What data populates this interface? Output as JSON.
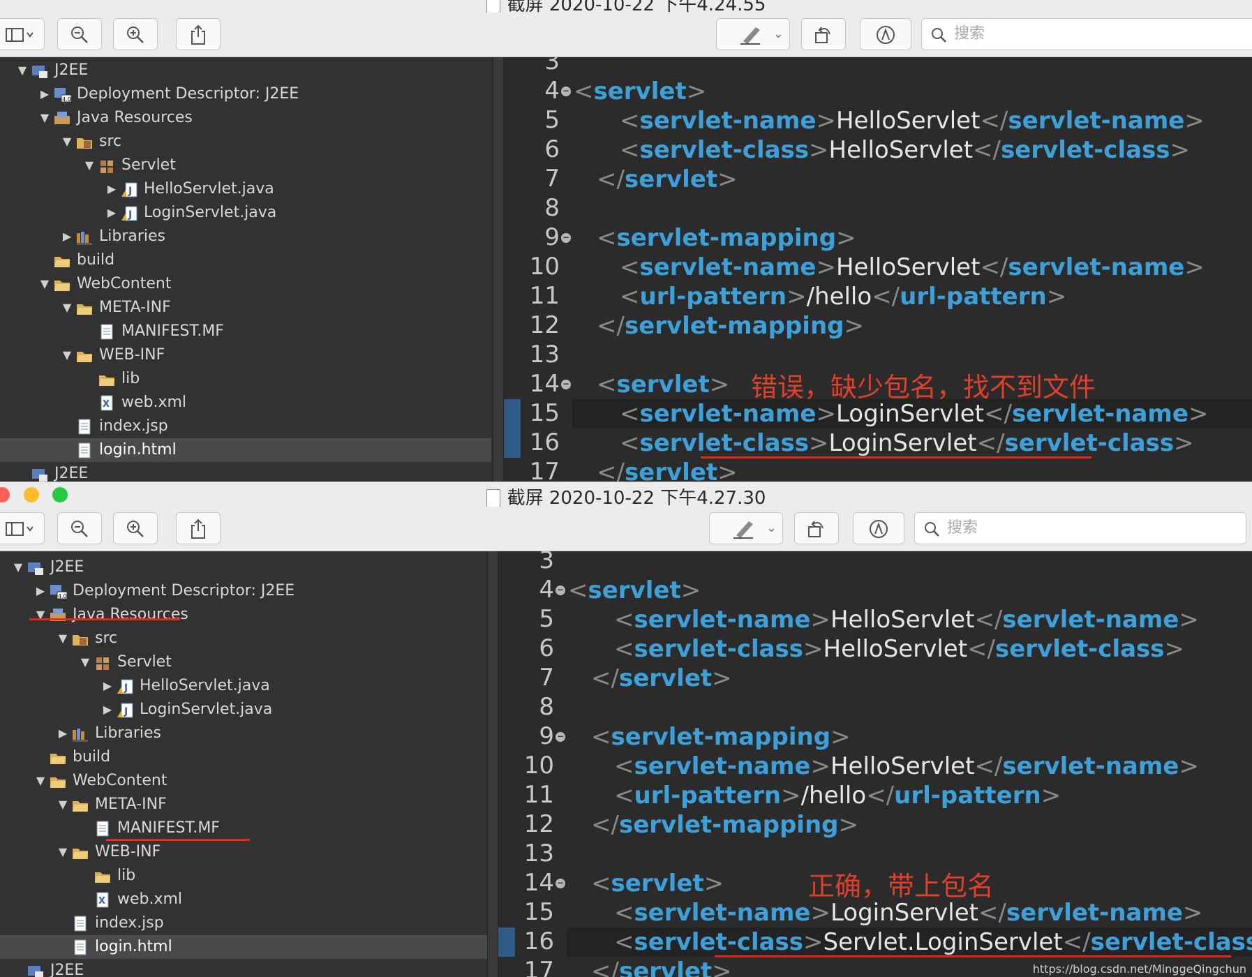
{
  "windows": [
    {
      "title": "截屏 2020-10-22 下午4.24.55",
      "search_placeholder": "搜索",
      "tree": {
        "root": "J2EE",
        "deployment": "Deployment Descriptor: J2EE",
        "java_resources": "Java Resources",
        "src": "src",
        "servlet_pkg": "Servlet",
        "hello_java": "HelloServlet.java",
        "login_java": "LoginServlet.java",
        "libraries": "Libraries",
        "build": "build",
        "webcontent": "WebContent",
        "meta_inf": "META-INF",
        "manifest": "MANIFEST.MF",
        "web_inf": "WEB-INF",
        "lib": "lib",
        "web_xml": "web.xml",
        "index_jsp": "index.jsp",
        "login_html": "login.html",
        "next_root": "J2EE"
      },
      "line_numbers": [
        "3",
        "4",
        "5",
        "6",
        "7",
        "8",
        "9",
        "10",
        "11",
        "12",
        "13",
        "14",
        "15",
        "16",
        "17"
      ],
      "code": {
        "l5_value": "HelloServlet",
        "l6_value": "HelloServlet",
        "l10_value": "HelloServlet",
        "l11_value": "/hello",
        "l15_value": "LoginServlet",
        "l16_value": "LoginServlet"
      },
      "annotation": "错误，缺少包名，找不到文件"
    },
    {
      "title": "截屏 2020-10-22 下午4.27.30",
      "search_placeholder": "搜索",
      "tree": {
        "root": "J2EE",
        "deployment": "Deployment Descriptor: J2EE",
        "java_resources": "Java Resources",
        "src": "src",
        "servlet_pkg": "Servlet",
        "hello_java": "HelloServlet.java",
        "login_java": "LoginServlet.java",
        "libraries": "Libraries",
        "build": "build",
        "webcontent": "WebContent",
        "meta_inf": "META-INF",
        "manifest": "MANIFEST.MF",
        "web_inf": "WEB-INF",
        "lib": "lib",
        "web_xml": "web.xml",
        "index_jsp": "index.jsp",
        "login_html": "login.html",
        "next_root": "J2EE"
      },
      "line_numbers": [
        "3",
        "4",
        "5",
        "6",
        "7",
        "8",
        "9",
        "10",
        "11",
        "12",
        "13",
        "14",
        "15",
        "16",
        "17"
      ],
      "code": {
        "l5_value": "HelloServlet",
        "l6_value": "HelloServlet",
        "l10_value": "HelloServlet",
        "l11_value": "/hello",
        "l15_value": "LoginServlet",
        "l16_value": "Servlet.LoginServlet"
      },
      "annotation": "正确，带上包名"
    }
  ],
  "tags": {
    "servlet": "servlet",
    "servlet_name": "servlet-name",
    "servlet_class": "servlet-class",
    "servlet_mapping": "servlet-mapping",
    "url_pattern": "url-pattern"
  },
  "watermark": "https://blog.csdn.net/MinggeQingchun",
  "colors": {
    "tag": "#3ea0d8",
    "bracket": "#8a8a8a",
    "annotation": "#e0402a",
    "underline": "#e02a1a",
    "sel_row": "#4a4a4a",
    "close": "#fe5f57",
    "min": "#febc2e",
    "max": "#28c840"
  }
}
